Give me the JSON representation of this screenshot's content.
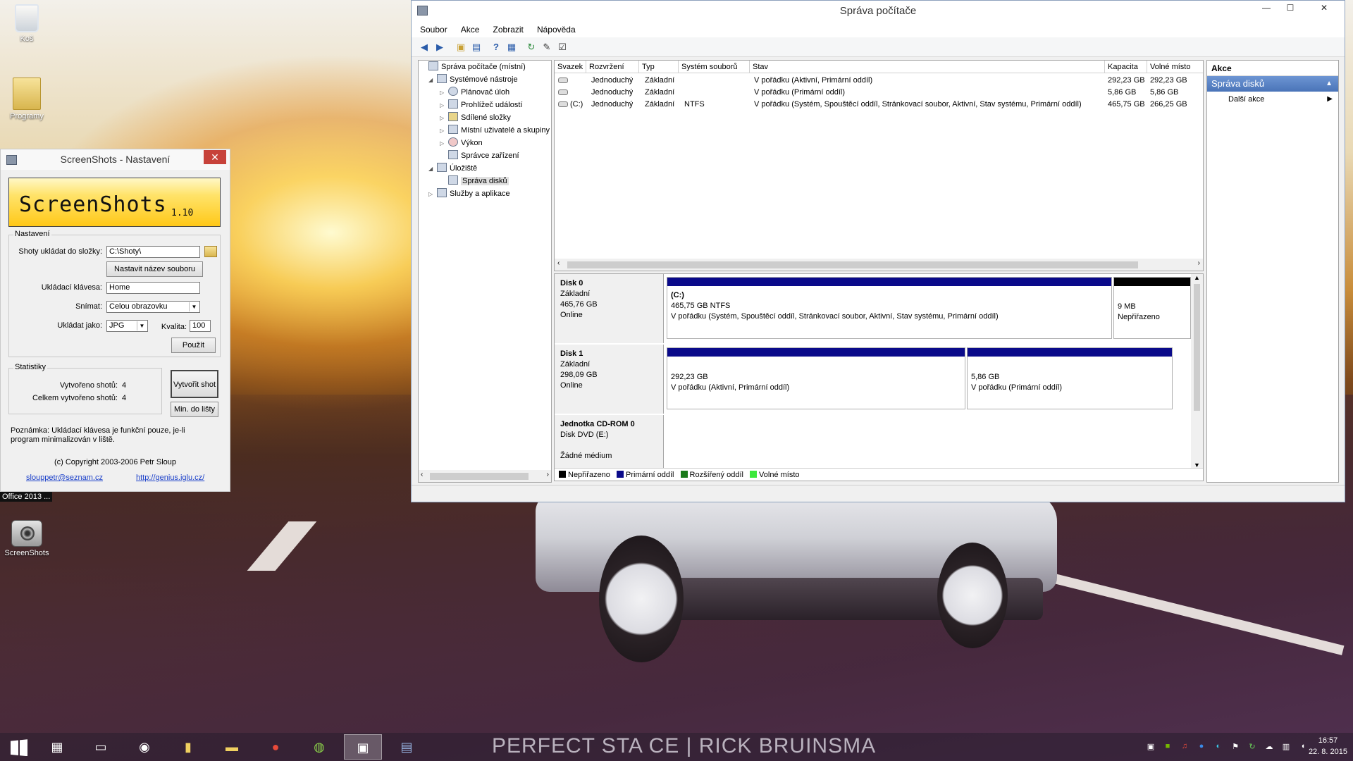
{
  "desktop": {
    "icons": [
      {
        "label": "Koš"
      },
      {
        "label": "Programy"
      },
      {
        "label": "ScreenShots"
      }
    ],
    "office_label": "Office 2013 ..."
  },
  "screenshots_window": {
    "title": "ScreenShots - Nastavení",
    "banner_name": "ScreenShots",
    "banner_version": "1.10",
    "settings_group": "Nastavení",
    "save_folder_label": "Shoty ukládat do složky:",
    "save_folder_value": "C:\\Shoty\\",
    "set_filename_button": "Nastavit název souboru",
    "hotkey_label": "Ukládací klávesa:",
    "hotkey_value": "Home",
    "capture_label": "Snímat:",
    "capture_value": "Celou obrazovku",
    "save_as_label": "Ukládat jako:",
    "save_as_value": "JPG",
    "quality_label": "Kvalita:",
    "quality_value": "100",
    "apply_button": "Použít",
    "stats_group": "Statistiky",
    "created_label": "Vytvořeno shotů:",
    "created_value": "4",
    "total_label": "Celkem vytvořeno shotů:",
    "total_value": "4",
    "create_shot_button": "Vytvořit shot",
    "minimize_button": "Min. do lišty",
    "note": "Poznámka: Ukládací klávesa je funkční pouze, je-li program minimalizován v liště.",
    "copyright": "(c) Copyright 2003-2006 Petr Sloup",
    "email_link": "slouppetr@seznam.cz",
    "web_link": "http://genius.iglu.cz/"
  },
  "computer_management": {
    "title": "Správa počítače",
    "menu": [
      "Soubor",
      "Akce",
      "Zobrazit",
      "Nápověda"
    ],
    "tree": [
      {
        "label": "Správa počítače (místní)",
        "level": 0,
        "expander": ""
      },
      {
        "label": "Systémové nástroje",
        "level": 1,
        "expander": "◢"
      },
      {
        "label": "Plánovač úloh",
        "level": 2,
        "expander": "▷"
      },
      {
        "label": "Prohlížeč událostí",
        "level": 2,
        "expander": "▷"
      },
      {
        "label": "Sdílené složky",
        "level": 2,
        "expander": "▷"
      },
      {
        "label": "Místní uživatelé a skupiny",
        "level": 2,
        "expander": "▷"
      },
      {
        "label": "Výkon",
        "level": 2,
        "expander": "▷"
      },
      {
        "label": "Správce zařízení",
        "level": 2,
        "expander": ""
      },
      {
        "label": "Úložiště",
        "level": 1,
        "expander": "◢"
      },
      {
        "label": "Správa disků",
        "level": 2,
        "expander": ""
      },
      {
        "label": "Služby a aplikace",
        "level": 1,
        "expander": "▷"
      }
    ],
    "columns": [
      "Svazek",
      "Rozvržení",
      "Typ",
      "Systém souborů",
      "Stav",
      "Kapacita",
      "Volné místo"
    ],
    "volumes": [
      {
        "svazek": "",
        "rozvrzeni": "Jednoduchý",
        "typ": "Základní",
        "fs": "",
        "stav": "V pořádku (Aktivní, Primární oddíl)",
        "kapacita": "292,23 GB",
        "volne": "292,23 GB"
      },
      {
        "svazek": "",
        "rozvrzeni": "Jednoduchý",
        "typ": "Základní",
        "fs": "",
        "stav": "V pořádku (Primární oddíl)",
        "kapacita": "5,86 GB",
        "volne": "5,86 GB"
      },
      {
        "svazek": "(C:)",
        "rozvrzeni": "Jednoduchý",
        "typ": "Základní",
        "fs": "NTFS",
        "stav": "V pořádku (Systém, Spouštěcí oddíl, Stránkovací soubor, Aktivní, Stav systému, Primární oddíl)",
        "kapacita": "465,75 GB",
        "volne": "266,25 GB"
      }
    ],
    "disks": {
      "disk0": {
        "name": "Disk 0",
        "type": "Základní",
        "size": "465,76 GB",
        "status": "Online",
        "part1": {
          "title": "(C:)",
          "size": "465,75 GB NTFS",
          "status": "V pořádku (Systém, Spouštěcí oddíl, Stránkovací soubor, Aktivní, Stav systému, Primární oddíl)"
        },
        "part2": {
          "size": "9 MB",
          "status": "Nepřiřazeno"
        }
      },
      "disk1": {
        "name": "Disk 1",
        "type": "Základní",
        "size": "298,09 GB",
        "status": "Online",
        "part1": {
          "size": "292,23 GB",
          "status": "V pořádku (Aktivní, Primární oddíl)"
        },
        "part2": {
          "size": "5,86 GB",
          "status": "V pořádku (Primární oddíl)"
        }
      },
      "cdrom": {
        "name": "Jednotka CD-ROM 0",
        "type": "Disk DVD (E:)",
        "status": "Žádné médium"
      }
    },
    "legend": [
      "Nepřiřazeno",
      "Primární oddíl",
      "Rozšířený oddíl",
      "Volné místo"
    ],
    "legend_colors": [
      "#000000",
      "#0a0a8a",
      "#1a7a1a",
      "#3ce83c"
    ],
    "actions_header": "Akce",
    "actions_selected": "Správa disků",
    "actions_more": "Další akce"
  },
  "taskbar": {
    "watermark": "PERFECT STA CE  |  RICK BRUINSMA",
    "clock_time": "16:57",
    "clock_date": "22. 8. 2015"
  }
}
